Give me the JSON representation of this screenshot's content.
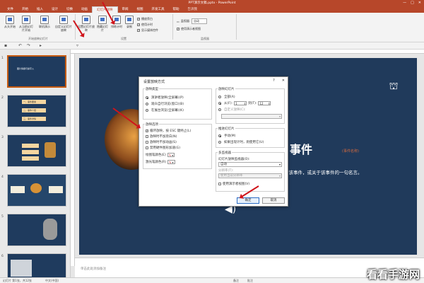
{
  "window": {
    "title": "PPT演示文稿.pptx - PowerPoint",
    "controls": [
      "—",
      "□",
      "✕"
    ]
  },
  "tabs": [
    "文件",
    "开始",
    "插入",
    "设计",
    "切换",
    "动画",
    "幻灯片放映",
    "审阅",
    "视图",
    "开发工具",
    "帮助",
    "告诉我"
  ],
  "active_tab": "幻灯片放映",
  "ribbon": {
    "buttons": [
      "从头开始",
      "从当前幻灯片开始",
      "联机演示",
      "自定义幻灯片放映",
      "设置幻灯片放映",
      "隐藏幻灯片",
      "排练计时",
      "录制"
    ],
    "groups": [
      "开始放映幻灯片",
      "设置",
      "监视器"
    ],
    "checks": [
      "播放旁白",
      "使用计时",
      "显示媒体控件"
    ],
    "monitor_label": "监视器:",
    "monitor_value": "自动",
    "presenter_view": "使用演示者视图"
  },
  "thumbs": [
    {
      "num": "1",
      "bars": [
        "图片情绪与操字入"
      ]
    },
    {
      "num": "2",
      "bars": [
        "一、事件要素",
        "二、事件介绍",
        "三、事件详情"
      ]
    },
    {
      "num": "3",
      "bars": [
        "",
        "",
        ""
      ]
    },
    {
      "num": "4",
      "bars": []
    },
    {
      "num": "5",
      "bars": []
    },
    {
      "num": "6",
      "bars": []
    }
  ],
  "slide": {
    "title": "事件",
    "tag": "(事件名称)",
    "subtitle": "结该事件，或关于该事件的一句名言。"
  },
  "notes_placeholder": "单击此处添加备注",
  "status": {
    "slide": "幻灯片 第1张，共12张",
    "lang": "中文(中国)",
    "notes": "备注",
    "comments": "批注"
  },
  "dialog": {
    "title": "设置放映方式",
    "title_buttons": [
      "?",
      "✕"
    ],
    "show_type": {
      "label": "放映类型",
      "options": [
        {
          "text": "演讲者放映(全屏幕)(P)",
          "on": true
        },
        {
          "text": "观众自行浏览(窗口)(B)",
          "on": false
        },
        {
          "text": "在展台浏览(全屏幕)(K)",
          "on": false
        }
      ]
    },
    "show_options": {
      "label": "放映选项",
      "items": [
        {
          "text": "循环放映，按 ESC 键终止(L)",
          "on": true
        },
        {
          "text": "放映时不加旁白(N)",
          "on": false
        },
        {
          "text": "放映时不加动画(S)",
          "on": false
        },
        {
          "text": "禁用硬件图形加速(G)",
          "on": false
        }
      ],
      "pen_color": "绘图笔颜色(E)",
      "laser_color": "激光笔颜色(R)"
    },
    "slides": {
      "label": "放映幻灯片",
      "all": "全部(A)",
      "from": "从(F):",
      "from_value": "1",
      "to": "到(T):",
      "to_value": "12",
      "custom": "自定义放映(C):"
    },
    "advance": {
      "label": "推进幻灯片",
      "manual": "手动(M)",
      "timings": "如果出现计时，则使用它(U)"
    },
    "monitors": {
      "label": "多监视器",
      "display_label": "幻灯片放映监视器(O):",
      "display_value": "自动",
      "resolution_label": "分辨率(T):",
      "resolution_value": "使用当前分辨率",
      "presenter": "使用演示者视图(V)"
    },
    "ok": "确定",
    "cancel": "取消"
  },
  "watermark": "看看手游网",
  "colors": {
    "accent": "#b7472a",
    "slide_bg": "#203a5b",
    "arrow": "#d0141b"
  }
}
